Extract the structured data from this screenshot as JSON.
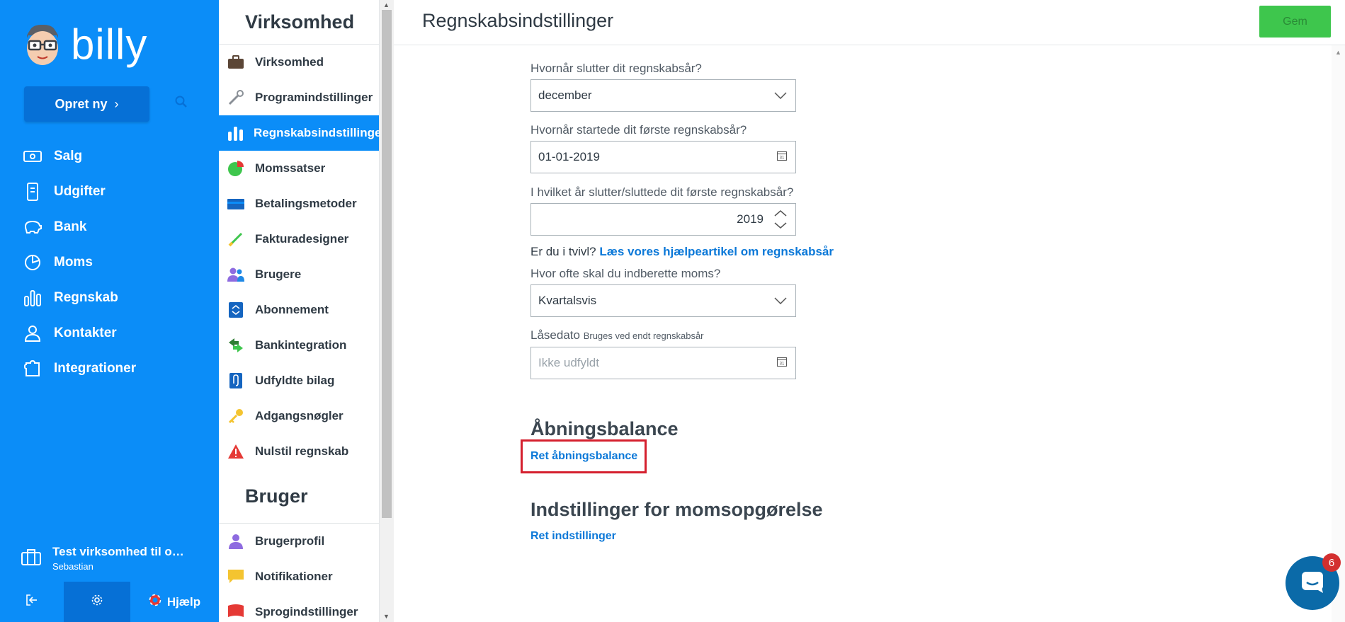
{
  "app": {
    "logo_text": "billy",
    "create_label": "Opret ny"
  },
  "nav": {
    "items": [
      {
        "label": "Salg",
        "icon": "money-icon"
      },
      {
        "label": "Udgifter",
        "icon": "receipt-icon"
      },
      {
        "label": "Bank",
        "icon": "piggy-bank-icon"
      },
      {
        "label": "Moms",
        "icon": "pie-chart-icon"
      },
      {
        "label": "Regnskab",
        "icon": "bar-chart-icon"
      },
      {
        "label": "Kontakter",
        "icon": "person-icon"
      },
      {
        "label": "Integrationer",
        "icon": "puzzle-icon"
      }
    ],
    "org_name": "Test virksomhed til ove…",
    "org_user": "Sebastian",
    "help_label": "Hjælp"
  },
  "sub": {
    "heading1": "Virksomhed",
    "items1": [
      "Virksomhed",
      "Programindstillinger",
      "Regnskabsindstillinger",
      "Momssatser",
      "Betalingsmetoder",
      "Fakturadesigner",
      "Brugere",
      "Abonnement",
      "Bankintegration",
      "Udfyldte bilag",
      "Adgangsnøgler",
      "Nulstil regnskab"
    ],
    "heading2": "Bruger",
    "items2": [
      "Brugerprofil",
      "Notifikationer",
      "Sprogindstillinger"
    ]
  },
  "main": {
    "title": "Regnskabsindstillinger",
    "save_label": "Gem",
    "fy_end_label": "Hvornår slutter dit regnskabsår?",
    "fy_end_value": "december",
    "first_start_label": "Hvornår startede dit første regnskabsår?",
    "first_start_value": "01-01-2019",
    "first_end_label": "I hvilket år slutter/sluttede dit første regnskabsår?",
    "first_end_value": "2019",
    "help_prefix": "Er du i tvivl?",
    "help_link": "Læs vores hjælpeartikel om regnskabsår",
    "vat_freq_label": "Hvor ofte skal du indberette moms?",
    "vat_freq_value": "Kvartalsvis",
    "lock_label": "Låsedato",
    "lock_hint": "Bruges ved endt regnskabsår",
    "lock_placeholder": "Ikke udfyldt",
    "opening_heading": "Åbningsbalance",
    "opening_link": "Ret åbningsbalance",
    "vat_heading": "Indstillinger for momsopgørelse",
    "vat_link": "Ret indstillinger"
  },
  "chat": {
    "badge": "6"
  },
  "colors": {
    "brand": "#0b8df8",
    "brand_dark": "#0670d6",
    "save": "#3ec64d",
    "link": "#0b78d8",
    "highlight": "#d5202e"
  }
}
